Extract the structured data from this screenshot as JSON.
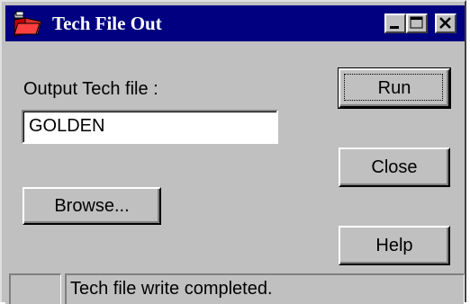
{
  "window": {
    "title": "Tech File Out",
    "controls": {
      "minimize_icon": "minimize-icon",
      "maximize_icon": "maximize-icon",
      "close_icon": "close-icon"
    }
  },
  "form": {
    "output_label": "Output Tech file :",
    "output_value": "GOLDEN",
    "browse_label": "Browse..."
  },
  "actions": {
    "run_label": "Run",
    "close_label": "Close",
    "help_label": "Help"
  },
  "status": {
    "left_pane": "",
    "message": "Tech file write completed."
  },
  "colors": {
    "titlebar": "#000080",
    "face": "#c0c0c0",
    "field": "#ffffff"
  }
}
